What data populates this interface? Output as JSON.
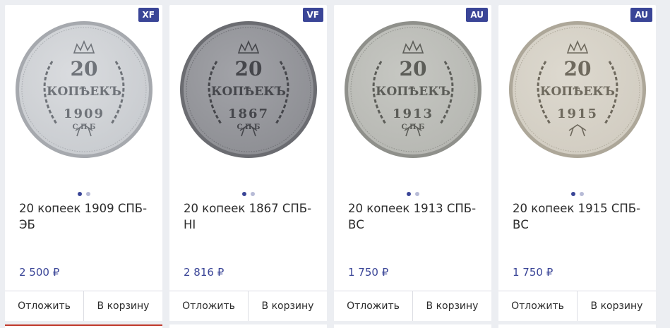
{
  "products": [
    {
      "grade": "XF",
      "title": "20 копеек 1909 СПБ-ЭБ",
      "price": "2 500 ₽",
      "coin": {
        "denomination": "20",
        "word": "КОПѢЕКЪ",
        "year": "1909",
        "mint": "С.П.Б"
      },
      "toning": "light"
    },
    {
      "grade": "VF",
      "title": "20 копеек 1867 СПБ-НІ",
      "price": "2 816 ₽",
      "coin": {
        "denomination": "20",
        "word": "КОПѢЕКЪ",
        "year": "1867",
        "mint": "С.П.Б"
      },
      "toning": "dark"
    },
    {
      "grade": "AU",
      "title": "20 копеек 1913 СПБ-ВС",
      "price": "1 750 ₽",
      "coin": {
        "denomination": "20",
        "word": "КОПѢЕКЪ",
        "year": "1913",
        "mint": "С.П.Б"
      },
      "toning": "medium"
    },
    {
      "grade": "AU",
      "title": "20 копеек 1915 СПБ-ВС",
      "price": "1 750 ₽",
      "coin": {
        "denomination": "20",
        "word": "КОПѢЕКЪ",
        "year": "1915",
        "mint": ""
      },
      "toning": "warm"
    }
  ],
  "labels": {
    "defer": "Отложить",
    "cart": "В корзину"
  },
  "colors": {
    "accent": "#3a4597",
    "dot_inactive": "#b7bbd6"
  },
  "icons": {
    "carousel": "slider-dots"
  }
}
